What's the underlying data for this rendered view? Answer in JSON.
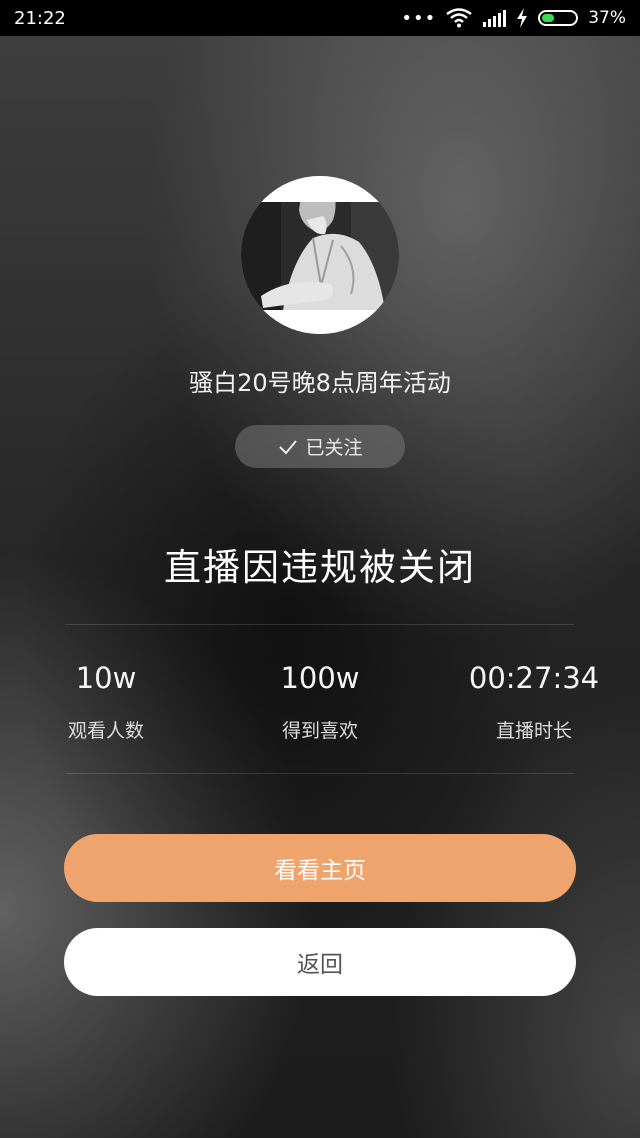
{
  "status_bar": {
    "time": "21:22",
    "dots": "•••",
    "battery_percent": "37%",
    "battery_level": 0.37,
    "icons": [
      "wifi-icon",
      "signal-icon",
      "charging-icon",
      "battery-icon"
    ],
    "battery_color": "#3ddc4a"
  },
  "streamer": {
    "name": "骚白20号晚8点周年活动",
    "follow_label": "已关注"
  },
  "message": {
    "title": "直播因违规被关闭"
  },
  "stats": [
    {
      "value": "10w",
      "label": "观看人数"
    },
    {
      "value": "100w",
      "label": "得到喜欢"
    },
    {
      "value": "00:27:34",
      "label": "直播时长"
    }
  ],
  "buttons": {
    "home_label": "看看主页",
    "back_label": "返回"
  },
  "colors": {
    "accent": "#f0a46d",
    "back_button_bg": "#ffffff"
  }
}
